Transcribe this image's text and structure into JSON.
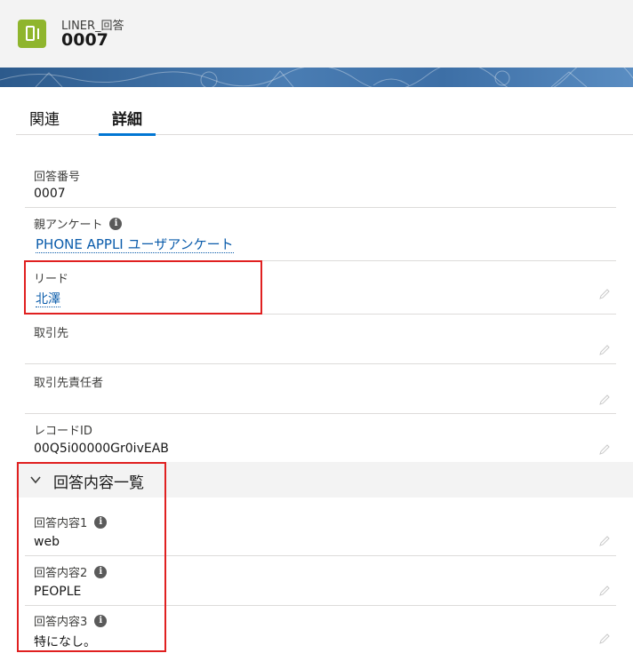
{
  "header": {
    "object_type": "LINER_回答",
    "record_name": "0007",
    "icon": "phone-app-icon"
  },
  "tabs": [
    {
      "label": "関連",
      "active": false
    },
    {
      "label": "詳細",
      "active": true
    }
  ],
  "fields": {
    "answer_number": {
      "label": "回答番号",
      "value": "0007"
    },
    "parent_survey": {
      "label": "親アンケート",
      "value": "PHONE APPLI ユーザアンケート"
    },
    "lead": {
      "label": "リード",
      "value": "北澤"
    },
    "account": {
      "label": "取引先",
      "value": ""
    },
    "contact": {
      "label": "取引先責任者",
      "value": ""
    },
    "record_id": {
      "label": "レコードID",
      "value": "00Q5i00000Gr0ivEAB"
    }
  },
  "section": {
    "title": "回答内容一覧",
    "icon": "chevron-down-icon"
  },
  "answers": [
    {
      "label": "回答内容1",
      "value": "web"
    },
    {
      "label": "回答内容2",
      "value": "PEOPLE"
    },
    {
      "label": "回答内容3",
      "value": "特になし。"
    }
  ],
  "colors": {
    "accent": "#0176d3",
    "link": "#0b5cab",
    "highlight": "#e02020",
    "object_icon": "#8fb52d"
  }
}
